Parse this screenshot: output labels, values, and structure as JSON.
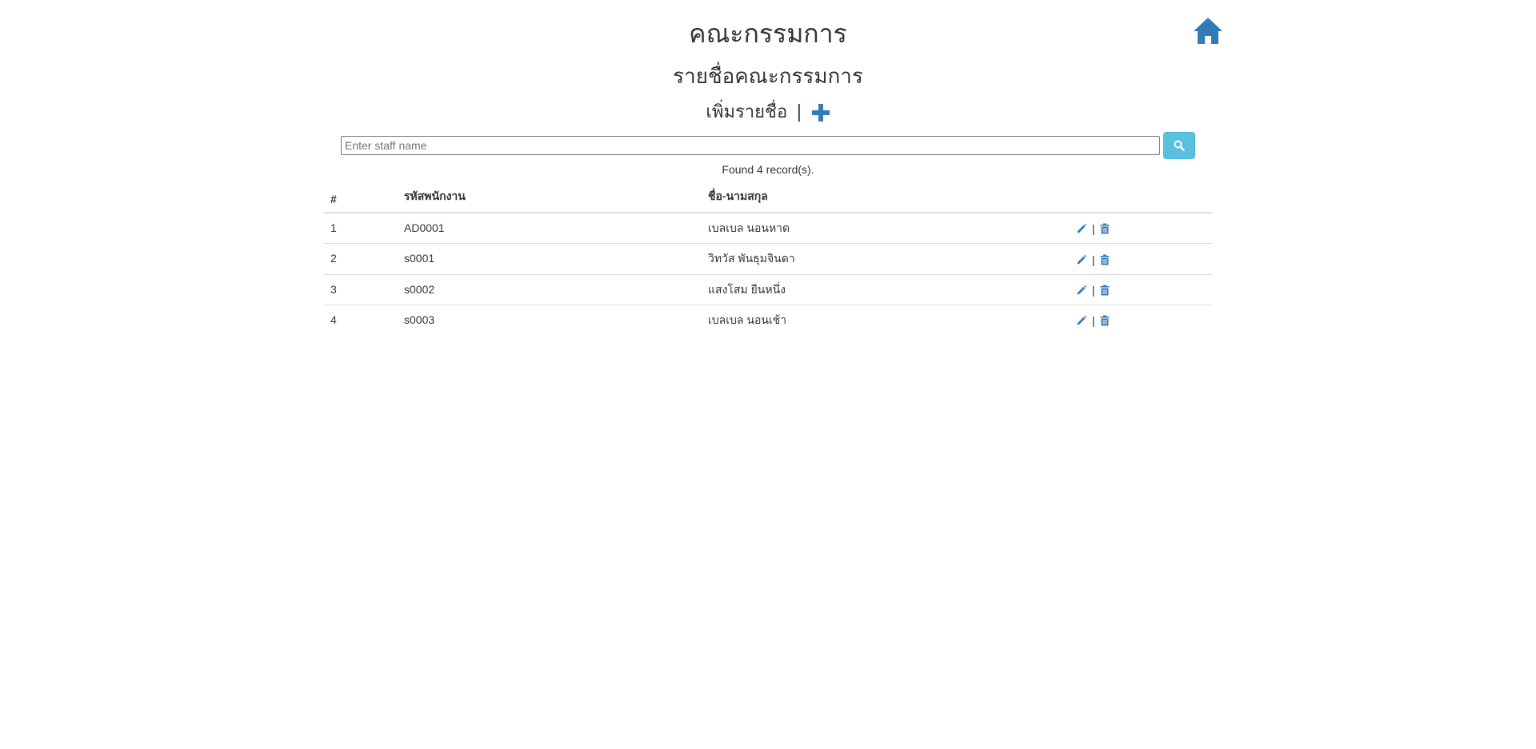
{
  "header": {
    "title": "คณะกรรมการ",
    "subtitle": "รายชื่อคณะกรรมการ",
    "add_label": "เพิ่มรายชื่อ",
    "add_separator": "|"
  },
  "search": {
    "placeholder": "Enter staff name",
    "value": ""
  },
  "result_text": "Found 4 record(s).",
  "table": {
    "columns": [
      "#",
      "รหัสพนักงาน",
      "ชื่อ-นามสกุล",
      ""
    ],
    "rows": [
      {
        "num": "1",
        "id": "AD0001",
        "name": "เบลเบล นอนหาด"
      },
      {
        "num": "2",
        "id": "s0001",
        "name": "วิทวัส พันธุมจินดา"
      },
      {
        "num": "3",
        "id": "s0002",
        "name": "แสงโสม ยืนหนึ่ง"
      },
      {
        "num": "4",
        "id": "s0003",
        "name": "เบลเบล นอนเช้า"
      }
    ],
    "action_separator": "|"
  },
  "colors": {
    "primary_icon": "#337ab7",
    "search_button": "#5bc0de",
    "text": "#333333"
  },
  "icons": {
    "home": "home-icon",
    "add": "plus-icon",
    "search": "search-icon",
    "edit": "pencil-icon",
    "delete": "trash-icon"
  }
}
